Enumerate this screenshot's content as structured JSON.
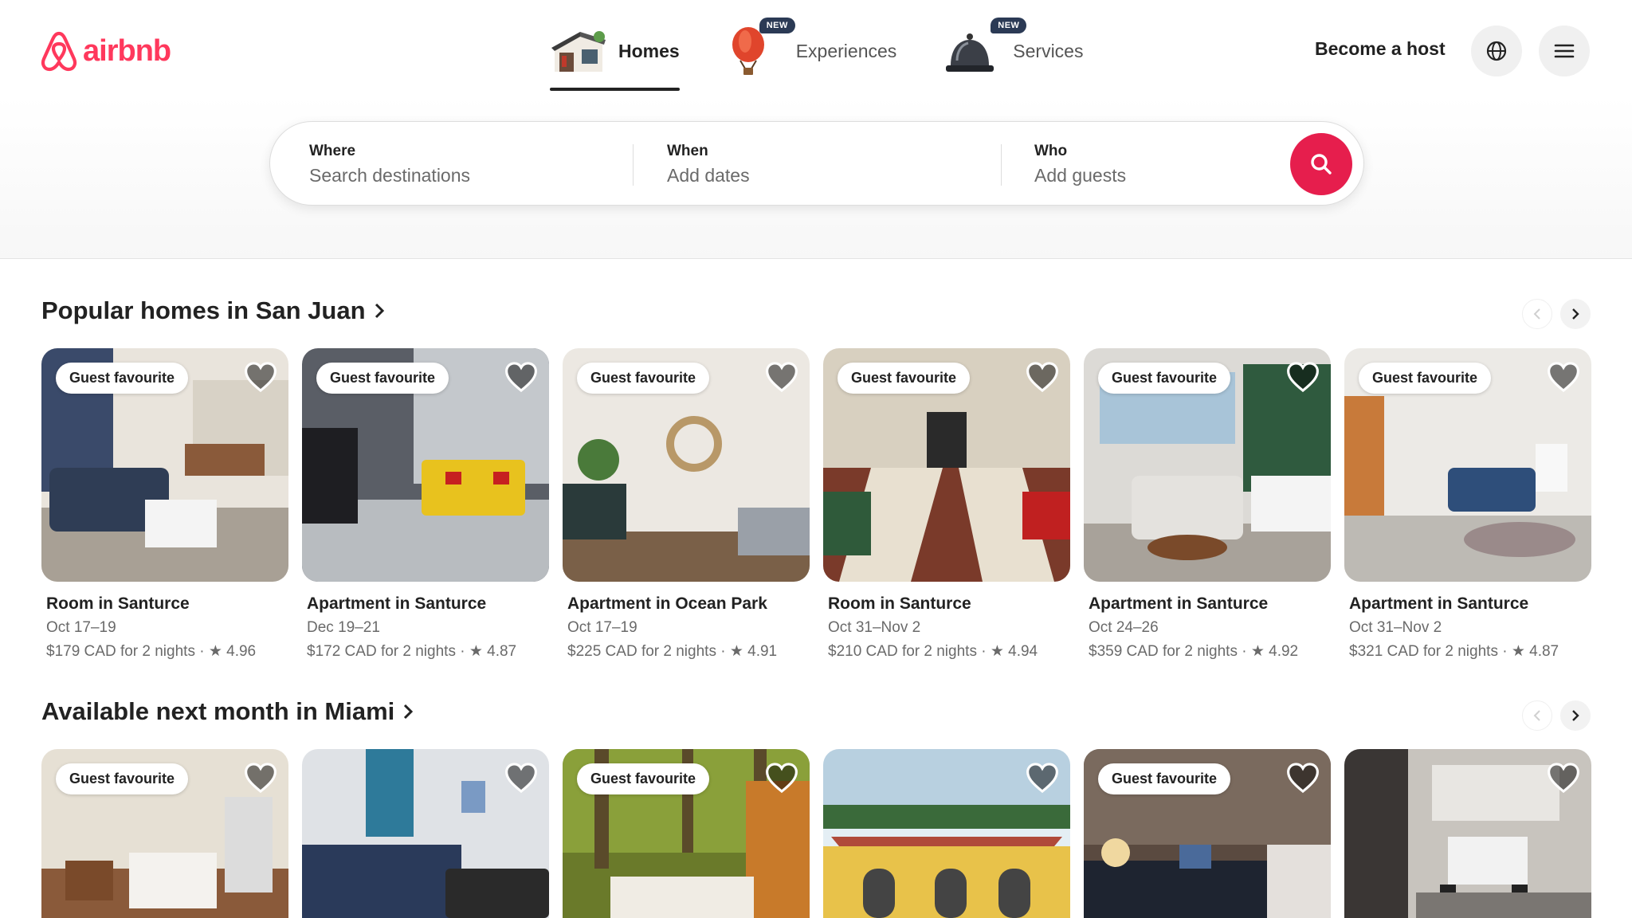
{
  "brand": {
    "name": "airbnb",
    "color": "#ff385c"
  },
  "nav": {
    "tabs": [
      {
        "label": "Homes",
        "icon": "house-icon",
        "active": true,
        "badge": ""
      },
      {
        "label": "Experiences",
        "icon": "hot-air-balloon-icon",
        "active": false,
        "badge": "NEW"
      },
      {
        "label": "Services",
        "icon": "service-bell-icon",
        "active": false,
        "badge": "NEW"
      }
    ],
    "host_link": "Become a host",
    "globe_icon": "globe-icon",
    "menu_icon": "hamburger-menu-icon"
  },
  "search": {
    "where_label": "Where",
    "where_placeholder": "Search destinations",
    "when_label": "When",
    "when_placeholder": "Add dates",
    "who_label": "Who",
    "who_placeholder": "Add guests",
    "button_icon": "search-icon",
    "button_color": "#e61e4d"
  },
  "sections": [
    {
      "title": "Popular homes in San Juan",
      "listings": [
        {
          "badge": "Guest favourite",
          "title": "Room in Santurce",
          "dates": "Oct 17–19",
          "price": "$179 CAD for 2 nights · ★ 4.96"
        },
        {
          "badge": "Guest favourite",
          "title": "Apartment in Santurce",
          "dates": "Dec 19–21",
          "price": "$172 CAD for 2 nights · ★ 4.87"
        },
        {
          "badge": "Guest favourite",
          "title": "Apartment in Ocean Park",
          "dates": "Oct 17–19",
          "price": "$225 CAD for 2 nights · ★ 4.91"
        },
        {
          "badge": "Guest favourite",
          "title": "Room in Santurce",
          "dates": "Oct 31–Nov 2",
          "price": "$210 CAD for 2 nights · ★ 4.94"
        },
        {
          "badge": "Guest favourite",
          "title": "Apartment in Santurce",
          "dates": "Oct 24–26",
          "price": "$359 CAD for 2 nights · ★ 4.92"
        },
        {
          "badge": "Guest favourite",
          "title": "Apartment in Santurce",
          "dates": "Oct 31–Nov 2",
          "price": "$321 CAD for 2 nights · ★ 4.87"
        }
      ]
    },
    {
      "title": "Available next month in Miami",
      "listings": [
        {
          "badge": "Guest favourite"
        },
        {
          "badge": ""
        },
        {
          "badge": "Guest favourite"
        },
        {
          "badge": ""
        },
        {
          "badge": "Guest favourite"
        },
        {
          "badge": ""
        }
      ]
    }
  ]
}
